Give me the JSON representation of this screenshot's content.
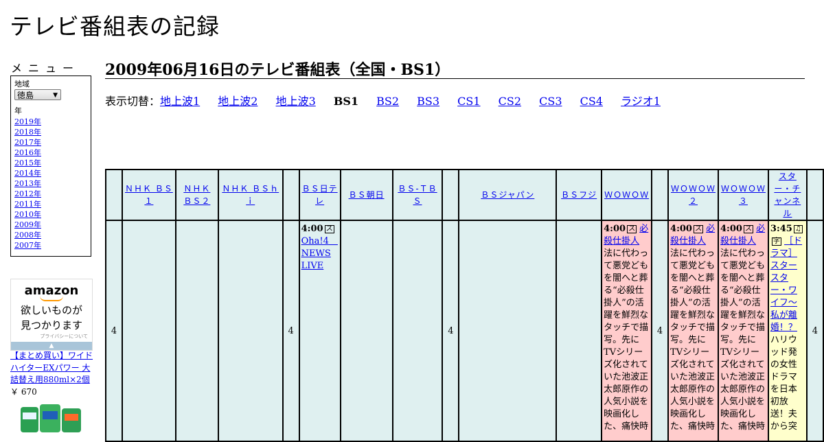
{
  "site_title": "テレビ番組表の記録",
  "sidebar": {
    "menu_heading": "メニュー",
    "region_label": "地域",
    "region_value": "徳島",
    "year_label": "年",
    "years": [
      "2019年",
      "2018年",
      "2017年",
      "2016年",
      "2015年",
      "2014年",
      "2013年",
      "2012年",
      "2011年",
      "2010年",
      "2009年",
      "2008年",
      "2007年"
    ]
  },
  "ad": {
    "logo": "amazon",
    "copy_line1": "欲しいものが",
    "copy_line2": "見つかります",
    "privacy": "プライバシーについて",
    "product_title": "【まとめ買い】ワイドハイターEXパワー 大詰替え用880ml×2個",
    "product_price": "￥ 670"
  },
  "page_heading": "2009年06月16日のテレビ番組表（全国・BS1）",
  "switcher": {
    "label": "表示切替：",
    "items": [
      "地上波1",
      "地上波2",
      "地上波3",
      "BS1",
      "BS2",
      "BS3",
      "CS1",
      "CS2",
      "CS3",
      "CS4",
      "ラジオ1"
    ],
    "current": "BS1"
  },
  "schedule": {
    "hour": "4",
    "channels": [
      "ＮＨＫ ＢＳ１",
      "ＮＨＫ ＢＳ２",
      "ＮＨＫ ＢＳｈｉ",
      "ＢＳ日テレ",
      "ＢＳ朝日",
      "ＢＳ-ＴＢＳ",
      "ＢＳジャパン",
      "ＢＳフジ",
      "ＷＯＷＯＷ",
      "ＷＯＷＯＷ２",
      "ＷＯＷＯＷ３",
      "スター・チャンネル"
    ],
    "programs": {
      "bs_nitele": {
        "time": "4:00",
        "title": "Oha!4　NEWS LIVE"
      },
      "wowow": {
        "time": "4:00",
        "title": "必殺仕掛人",
        "desc": "法に代わって悪党どもを闇へと葬る“必殺仕掛人”の活躍を鮮烈なタッチで描写。先にTVシリーズ化されていた池波正太郎原作の人気小説を映画化した、痛快時"
      },
      "wowow2": {
        "time": "4:00",
        "title": "必殺仕掛人",
        "desc": "法に代わって悪党どもを闇へと葬る“必殺仕掛人”の活躍を鮮烈なタッチで描写。先にTVシリーズ化されていた池波正太郎原作の人気小説を映画化した、痛快時"
      },
      "wowow3": {
        "time": "4:00",
        "title": "必殺仕掛人",
        "desc": "法に代わって悪党どもを闇へと葬る“必殺仕掛人”の活躍を鮮烈なタッチで描写。先にTVシリーズ化されていた池波正太郎原作の人気小説を映画化した、痛快時"
      },
      "star": {
        "time": "3:45",
        "title": "［ドラマ］スタースター・ワイフ～私が離婚！？",
        "desc": "ハリウッド発の女性ドラマを日本初放送！夫から突"
      }
    }
  }
}
